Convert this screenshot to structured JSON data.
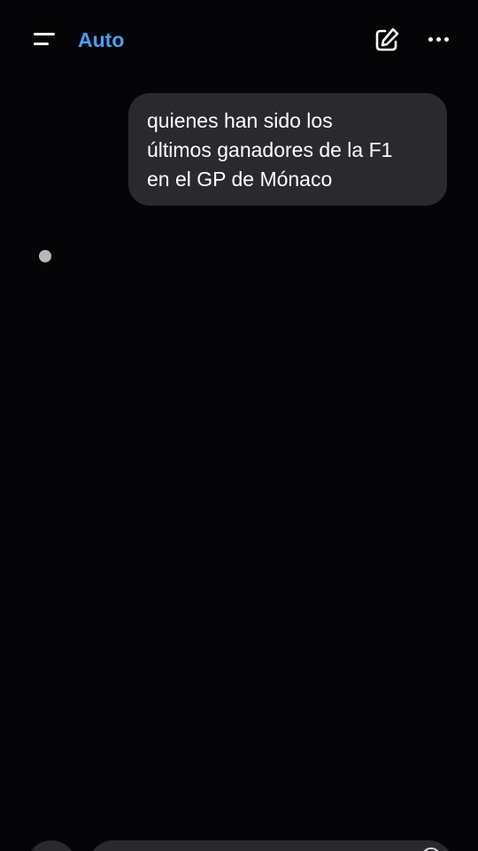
{
  "header": {
    "model_label": "Auto",
    "menu_icon": "menu-icon",
    "edit_icon": "new-chat-edit-icon",
    "more_icon": "more-horizontal-icon"
  },
  "conversation": {
    "user_message": "quienes han sido los\núltimos ganadores de la F1\nen el GP de Mónaco",
    "assistant_state": "loading-dot"
  },
  "composer": {
    "left_icon": "plus-icon",
    "right_icon": "voice-icon"
  },
  "colors": {
    "background": "#050407",
    "bubble": "#2a292e",
    "accent": "#4a9ff5",
    "loading_dot": "#b9b9bc"
  }
}
